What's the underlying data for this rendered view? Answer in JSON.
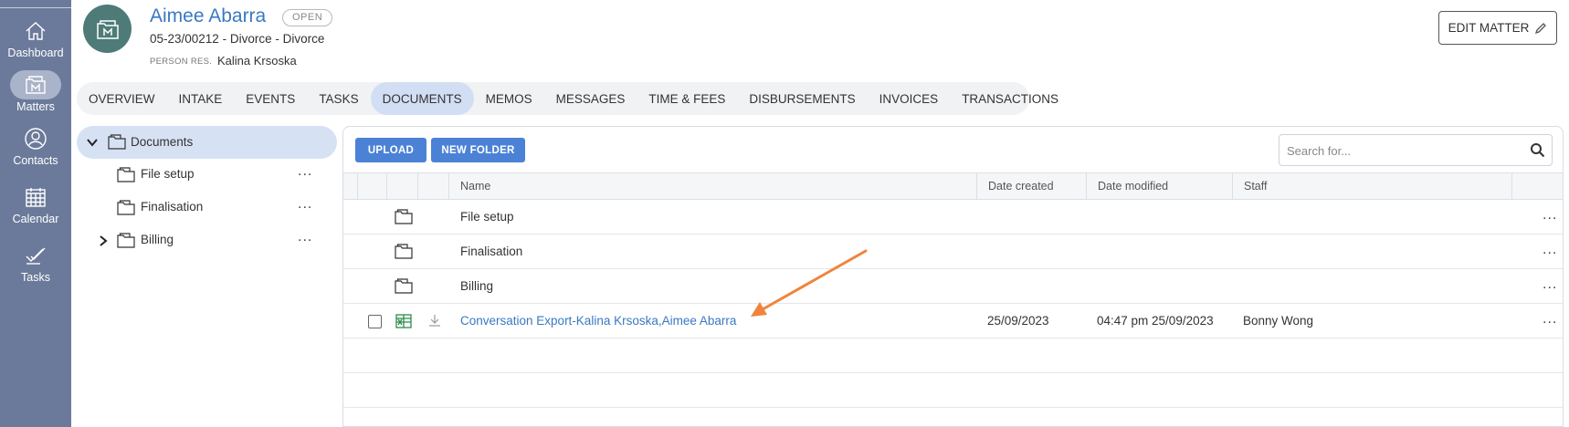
{
  "nav": {
    "items": [
      {
        "label": "Dashboard",
        "icon": "home-icon"
      },
      {
        "label": "Matters",
        "icon": "matters-icon"
      },
      {
        "label": "Contacts",
        "icon": "contacts-icon"
      },
      {
        "label": "Calendar",
        "icon": "calendar-icon"
      },
      {
        "label": "Tasks",
        "icon": "tasks-icon"
      }
    ],
    "active": "Matters"
  },
  "header": {
    "client_name": "Aimee Abarra",
    "status": "OPEN",
    "matter_line": "05-23/00212 - Divorce - Divorce",
    "person_responsible_label": "PERSON RES.",
    "person_responsible": "Kalina Krsoska",
    "edit_label": "EDIT MATTER"
  },
  "tabs": [
    {
      "label": "OVERVIEW"
    },
    {
      "label": "INTAKE"
    },
    {
      "label": "EVENTS"
    },
    {
      "label": "TASKS"
    },
    {
      "label": "DOCUMENTS",
      "active": true
    },
    {
      "label": "MEMOS"
    },
    {
      "label": "MESSAGES"
    },
    {
      "label": "TIME & FEES"
    },
    {
      "label": "DISBURSEMENTS"
    },
    {
      "label": "INVOICES"
    },
    {
      "label": "TRANSACTIONS"
    }
  ],
  "tree": {
    "root": "Documents",
    "children": [
      {
        "label": "File setup",
        "more": "..."
      },
      {
        "label": "Finalisation",
        "more": "..."
      },
      {
        "label": "Billing",
        "more": "..."
      }
    ]
  },
  "docs": {
    "upload_label": "UPLOAD",
    "new_folder_label": "NEW FOLDER",
    "search_placeholder": "Search for...",
    "columns": {
      "name": "Name",
      "date_created": "Date created",
      "date_modified": "Date modified",
      "staff": "Staff"
    },
    "rows": [
      {
        "name": "File setup",
        "more": "..."
      },
      {
        "name": "Finalisation",
        "more": "..."
      },
      {
        "name": "Billing",
        "more": "..."
      },
      {
        "name": "Conversation Export-Kalina Krsoska,Aimee Abarra",
        "date_created": "25/09/2023",
        "date_modified": "04:47 pm 25/09/2023",
        "staff": "Bonny Wong",
        "more": "..."
      }
    ]
  },
  "colors": {
    "nav_bg": "#6b7a9a",
    "accent": "#4b82d6",
    "link": "#3a78c3",
    "avatar": "#4e7b78",
    "arrow": "#f0843c"
  }
}
